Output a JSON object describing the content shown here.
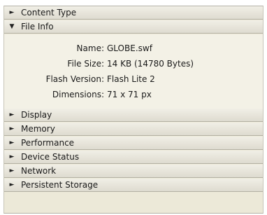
{
  "sections": [
    {
      "label": "Content Type",
      "expanded": false,
      "arrow": "►"
    },
    {
      "label": "File Info",
      "expanded": true,
      "arrow": "▼"
    },
    {
      "label": "Display",
      "expanded": false,
      "arrow": "►"
    },
    {
      "label": "Memory",
      "expanded": false,
      "arrow": "►"
    },
    {
      "label": "Performance",
      "expanded": false,
      "arrow": "►"
    },
    {
      "label": "Device Status",
      "expanded": false,
      "arrow": "►"
    },
    {
      "label": "Network",
      "expanded": false,
      "arrow": "►"
    },
    {
      "label": "Persistent Storage",
      "expanded": false,
      "arrow": "►"
    }
  ],
  "file_info": {
    "name_label": "Name:",
    "name_value": "GLOBE.swf",
    "size_label": "File Size:",
    "size_value": "14 KB (14780 Bytes)",
    "flash_label": "Flash Version:",
    "flash_value": "Flash Lite 2",
    "dimensions_label": "Dimensions:",
    "dimensions_value": "71 x 71 px"
  }
}
